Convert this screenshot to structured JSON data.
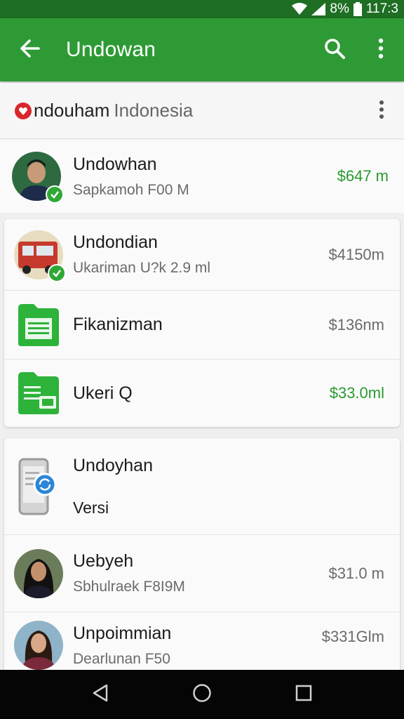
{
  "status_bar": {
    "battery": "8%",
    "time": "117:3",
    "icons": [
      "wifi-icon",
      "signal-icon",
      "battery-icon"
    ]
  },
  "app_bar": {
    "title": "Undowan",
    "back_icon": "arrow-back-icon",
    "search_icon": "search-icon",
    "more_icon": "more-vert-icon"
  },
  "header": {
    "brand": "ndouham",
    "subtitle": "Indonesia",
    "more_icon": "more-vert-icon"
  },
  "list_top": [
    {
      "title": "Undowhan",
      "subtitle": "Sapkamoh F00 M",
      "amount": "$647 m",
      "amount_color": "#2a9a30",
      "icon": "avatar-man",
      "verified": true
    }
  ],
  "card_one": [
    {
      "title": "Undondian",
      "subtitle": "Ukariman U?k 2.9 ml",
      "amount": "$4150m",
      "amount_color": "#6b6b6b",
      "icon": "bus-avatar",
      "verified": true
    },
    {
      "title": "Fikanizman",
      "subtitle": "",
      "amount": "$136nm",
      "amount_color": "#6b6b6b",
      "icon": "document-icon",
      "verified": false
    },
    {
      "title": "Ukeri Q",
      "subtitle": "",
      "amount": "$33.0ml",
      "amount_color": "#2a9a30",
      "icon": "document-card-icon",
      "verified": false
    }
  ],
  "card_two": {
    "update_row": {
      "title": "Undoyhan",
      "subtitle": "Versi",
      "icon": "phone-update-icon"
    },
    "rows": [
      {
        "title": "Uebyeh",
        "subtitle": "Sbhulraek F8I9M",
        "amount": "$31.0 m",
        "amount_color": "#6b6b6b",
        "icon": "avatar-woman"
      },
      {
        "title": "Unpoimmian",
        "subtitle": "Dearlunan F50",
        "amount": "$331Glm",
        "amount_color": "#6b6b6b",
        "icon": "avatar-woman-2"
      }
    ]
  },
  "nav_bar": {
    "icons": [
      "back-triangle-icon",
      "home-circle-icon",
      "recents-square-icon"
    ]
  },
  "colors": {
    "primary": "#2e9a35",
    "status_bar": "#1e6e24",
    "accent_green": "#2a9a30"
  }
}
